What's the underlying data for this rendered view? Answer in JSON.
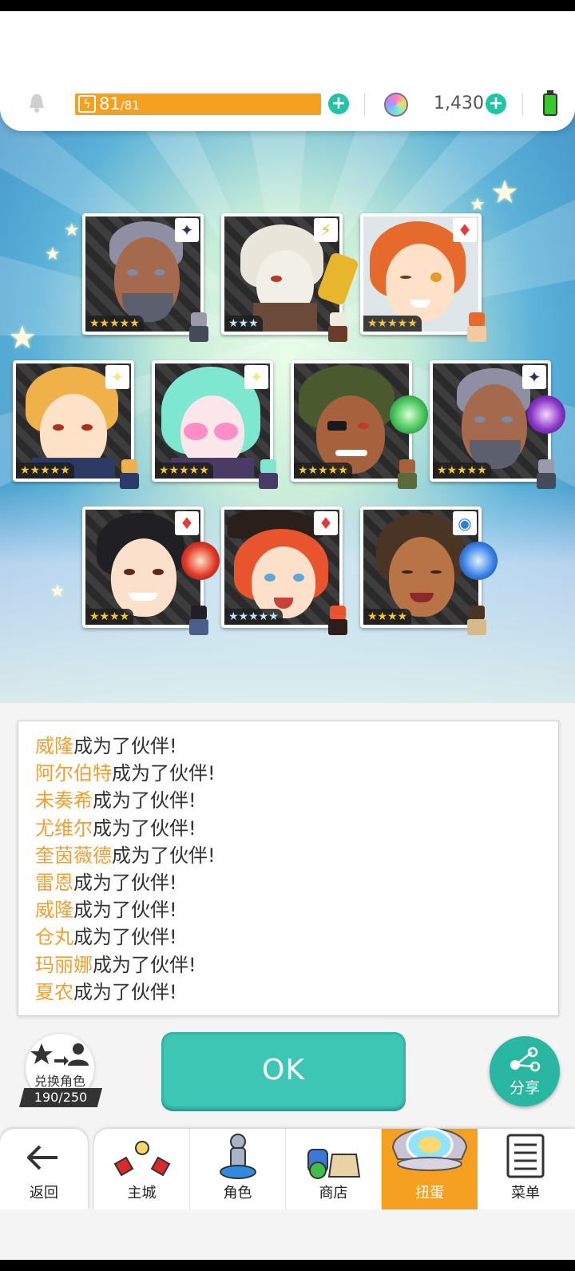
{
  "topbar": {
    "energy_current": "81",
    "energy_max": "/81",
    "gem_count": "1,430",
    "icons": [
      "bell-icon",
      "bolt-icon",
      "plus-icon",
      "gem-icon",
      "battery-icon"
    ]
  },
  "cards": [
    {
      "id": "w1",
      "stars": "★★★★★",
      "element": "✦",
      "element_name": "dark",
      "star_color": "gold"
    },
    {
      "id": "w2",
      "stars": "★★★",
      "element": "⚡",
      "element_name": "lightning",
      "star_color": "blue"
    },
    {
      "id": "w3",
      "stars": "★★★★★",
      "element": "♦",
      "element_name": "fire",
      "star_color": "gold"
    },
    {
      "id": "w4",
      "stars": "★★★★★",
      "element": "✦",
      "element_name": "light",
      "star_color": "gold"
    },
    {
      "id": "w5",
      "stars": "★★★★★",
      "element": "✦",
      "element_name": "light",
      "star_color": "gold"
    },
    {
      "id": "w6",
      "stars": "★★★★★",
      "element": "",
      "element_name": "earth",
      "star_color": "gold"
    },
    {
      "id": "w7",
      "stars": "★★★★★",
      "element": "✦",
      "element_name": "dark",
      "star_color": "gold"
    },
    {
      "id": "w8",
      "stars": "★★★★",
      "element": "♦",
      "element_name": "fire",
      "star_color": "gold"
    },
    {
      "id": "w9",
      "stars": "★★★★★",
      "element": "♦",
      "element_name": "fire",
      "star_color": "blue"
    },
    {
      "id": "w10",
      "stars": "★★★★",
      "element": "◉",
      "element_name": "water",
      "star_color": "gold"
    }
  ],
  "log": {
    "suffix": "成为了伙伴!",
    "names": [
      "威隆",
      "阿尔伯特",
      "未奏希",
      "尤维尔",
      "奎茵薇德",
      "雷恩",
      "威隆",
      "仓丸",
      "玛丽娜",
      "夏农"
    ]
  },
  "actions": {
    "swap_label": "兑换角色",
    "swap_count": "190/250",
    "ok_label": "OK",
    "share_label": "分享"
  },
  "nav": {
    "back_label": "返回",
    "items": [
      {
        "label": "主城",
        "icon": "castle-icon"
      },
      {
        "label": "角色",
        "icon": "hero-statue-icon"
      },
      {
        "label": "商店",
        "icon": "shop-bag-icon"
      },
      {
        "label": "扭蛋",
        "icon": "gacha-icon",
        "active": true
      },
      {
        "label": "菜单",
        "icon": "menu-list-icon"
      }
    ]
  },
  "colors": {
    "energy": "#f5a021",
    "accent": "#3ec6b5",
    "name_highlight": "#f0a031",
    "nav_active": "#f5a021"
  }
}
